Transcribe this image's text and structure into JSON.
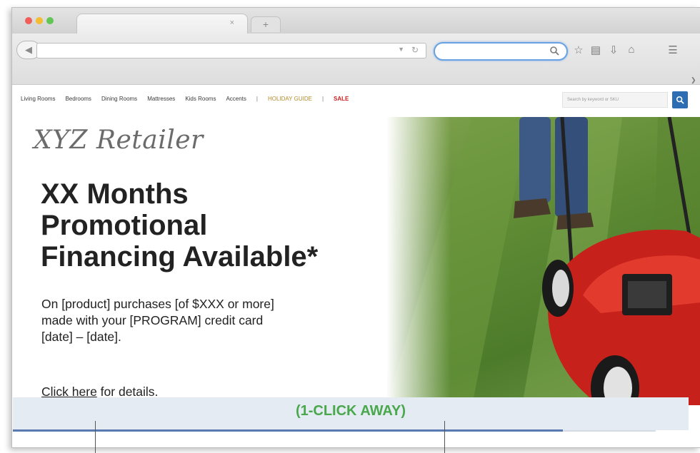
{
  "browser": {
    "new_tab_label": "+",
    "tab_close_label": "×",
    "icons": [
      "back-arrow-icon",
      "dropdown-icon",
      "reload-icon",
      "search-icon",
      "bookmark-star-icon",
      "library-icon",
      "download-icon",
      "home-icon",
      "menu-icon",
      "chevron-right-icon"
    ],
    "accent_color": "#6aa1e3"
  },
  "site_nav": {
    "items": [
      "Living Rooms",
      "Bedrooms",
      "Dining Rooms",
      "Mattresses",
      "Kids Rooms",
      "Accents"
    ],
    "holiday_guide": "HOLIDAY GUIDE",
    "sale": "SALE",
    "separator": "|",
    "search_placeholder": "Search by keyword or SKU",
    "search_button_color": "#2d6db4"
  },
  "hero": {
    "logo": "XYZ Retailer",
    "headline": [
      "XX Months",
      "Promotional",
      "Financing Available*"
    ],
    "body": [
      "On [product] purchases [of $XXX or more]",
      "made with your [PROGRAM] credit card",
      "[date] – [date]."
    ],
    "details_link": "Click here",
    "details_suffix": " for details."
  },
  "annotation": {
    "label": "(1-CLICK AWAY)",
    "color": "#49a84b"
  }
}
